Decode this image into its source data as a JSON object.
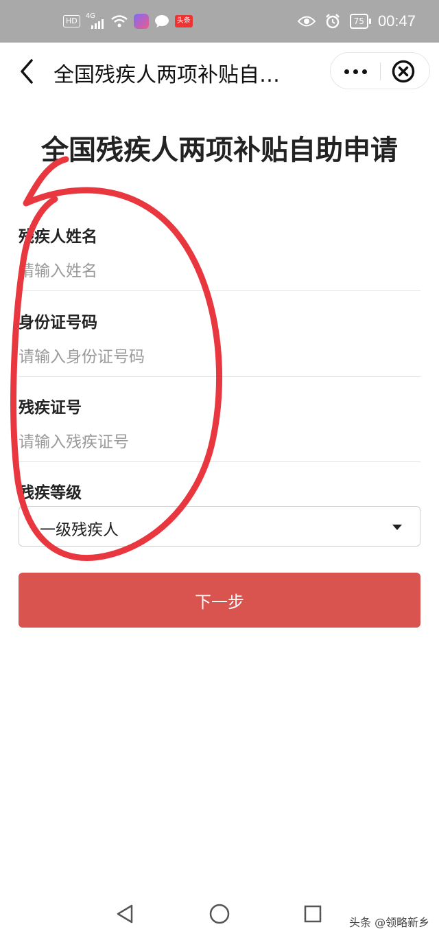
{
  "status_bar": {
    "hd": "HD",
    "network": "4G",
    "toutiao_badge": "头条",
    "battery": "75",
    "time": "00:47"
  },
  "nav": {
    "title": "全国残疾人两项补贴自…"
  },
  "page": {
    "title": "全国残疾人两项补贴自助申请"
  },
  "form": {
    "name": {
      "label": "残疾人姓名",
      "placeholder": "请输入姓名"
    },
    "id_number": {
      "label": "身份证号码",
      "placeholder": "请输入身份证号码"
    },
    "disability_cert": {
      "label": "残疾证号",
      "placeholder": "请输入残疾证号"
    },
    "disability_level": {
      "label": "残疾等级",
      "value": "一级残疾人"
    },
    "next_label": "下一步"
  },
  "annotation": {
    "color": "#e8373f"
  },
  "watermark": "头条 @领略新乡"
}
